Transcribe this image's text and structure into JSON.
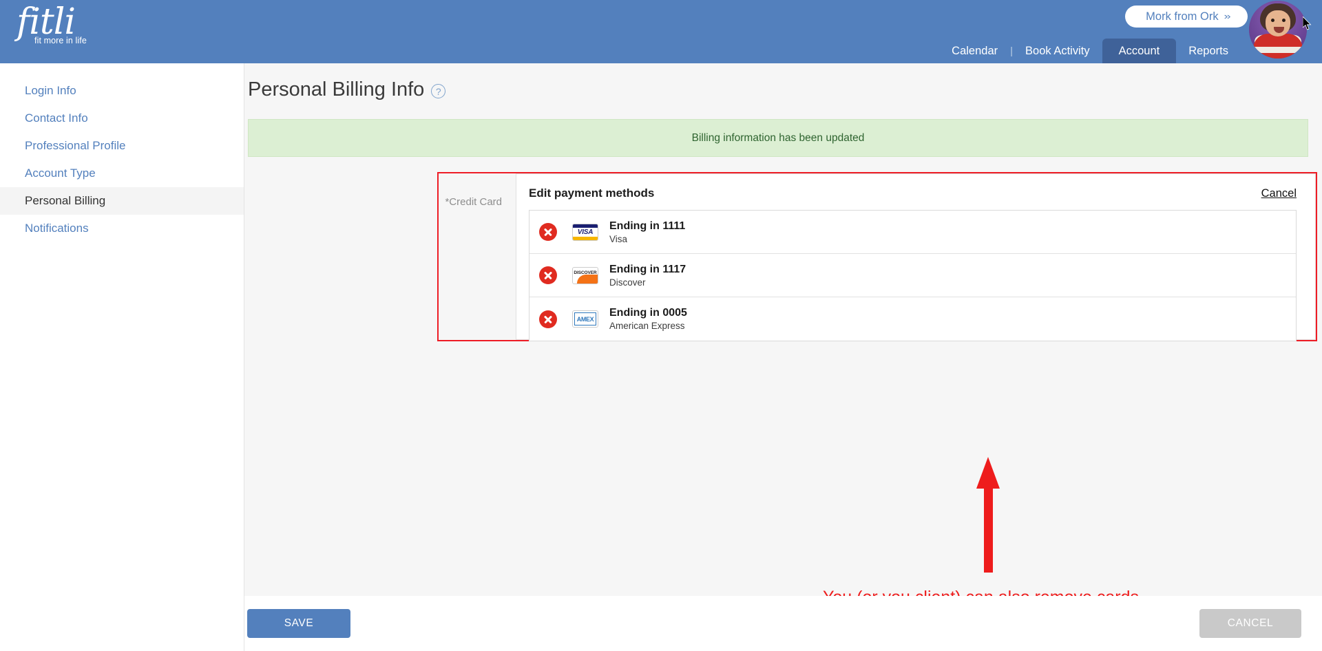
{
  "header": {
    "logo_word": "fitli",
    "logo_tagline": "fit more in life",
    "user_name": "Mork from Ork",
    "chevron": "»",
    "nav": [
      {
        "label": "Calendar",
        "active": false
      },
      {
        "label": "Book Activity",
        "active": false
      },
      {
        "label": "Account",
        "active": true
      },
      {
        "label": "Reports",
        "active": false
      }
    ],
    "nav_separator": "|"
  },
  "sidebar": {
    "items": [
      {
        "label": "Login Info",
        "active": false
      },
      {
        "label": "Contact Info",
        "active": false
      },
      {
        "label": "Professional Profile",
        "active": false
      },
      {
        "label": "Account Type",
        "active": false
      },
      {
        "label": "Personal Billing",
        "active": true
      },
      {
        "label": "Notifications",
        "active": false
      }
    ]
  },
  "main": {
    "page_title": "Personal Billing Info",
    "help_icon_glyph": "?",
    "alert_message": "Billing information has been updated",
    "field_label": "*Credit Card",
    "panel_heading": "Edit payment methods",
    "panel_cancel_link": "Cancel",
    "cards": [
      {
        "last4_text": "Ending in 1111",
        "brand": "Visa",
        "brand_key": "visa",
        "brand_mark": "VISA",
        "remove_icon": "remove-circle-icon"
      },
      {
        "last4_text": "Ending in 1117",
        "brand": "Discover",
        "brand_key": "discover",
        "brand_mark": "DISCOVER",
        "remove_icon": "remove-circle-icon"
      },
      {
        "last4_text": "Ending in 0005",
        "brand": "American Express",
        "brand_key": "amex",
        "brand_mark": "AMEX",
        "remove_icon": "remove-circle-icon"
      }
    ]
  },
  "annotation": {
    "text": "You (or you client) can also remove cards.",
    "color": "#ee1c1c",
    "arrow": "up-arrow-annotation",
    "box": "red-highlight-box"
  },
  "footer": {
    "save_label": "SAVE",
    "cancel_label": "CANCEL"
  },
  "colors": {
    "brand_blue": "#5380bd",
    "nav_active_blue": "#3f6299",
    "success_green_bg": "#dcefd3",
    "success_green_text": "#2f6430",
    "annotation_red": "#ee1c1c",
    "remove_red": "#e02b20",
    "disabled_grey": "#c9c9c9"
  }
}
